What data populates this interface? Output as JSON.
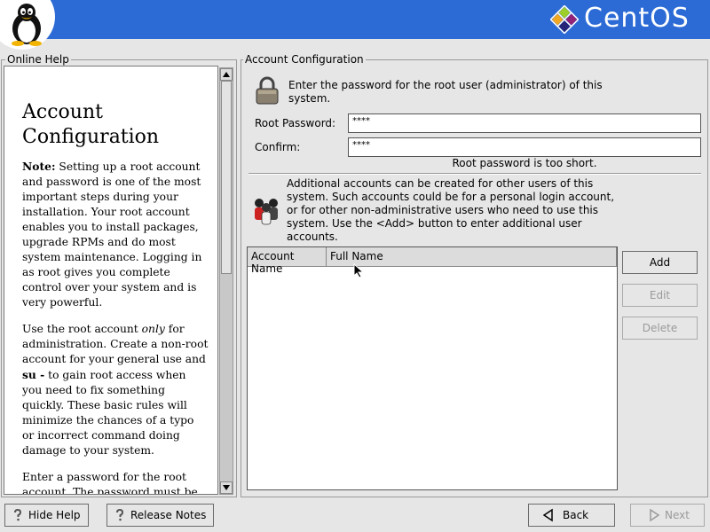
{
  "header": {
    "brand": "CentOS"
  },
  "help": {
    "frame_label": "Online Help",
    "title": "Account Configuration",
    "p1_bold": "Note:",
    "p1": "Setting up a root account and password is one of the most important steps during your installation. Your root account enables you to install packages, upgrade RPMs and do most system maintenance. Logging in as root gives you complete control over your system and is very powerful.",
    "p2_a": "Use the root account",
    "p2_em": "only",
    "p2_b": "for administration. Create a non-root account for your general use and",
    "p2_bold": "su -",
    "p2_c": "to gain root access when you need to fix something quickly. These basic rules will minimize the chances of a typo or incorrect command doing damage to your system.",
    "p3": "Enter a password for the root account. The password must be at least six characters in length."
  },
  "account": {
    "frame_label": "Account Configuration",
    "intro_line1": "Enter the password for the root user (administrator) of this",
    "intro_line2": "system.",
    "root_password_label": "Root Password:",
    "root_password_value": "****",
    "confirm_label": "Confirm:",
    "confirm_value": "****",
    "status": "Root password is too short.",
    "additional": "Additional accounts can be created for other users of this system. Such accounts could be for a personal login account, or for other non-administrative users who need to use this system. Use the <Add> button to enter additional user accounts.",
    "columns": [
      "Account Name",
      "Full Name"
    ],
    "buttons": {
      "add": "Add",
      "edit": "Edit",
      "delete": "Delete"
    }
  },
  "footer": {
    "hide_help": "Hide Help",
    "release_notes": "Release Notes",
    "back": "Back",
    "next": "Next"
  }
}
